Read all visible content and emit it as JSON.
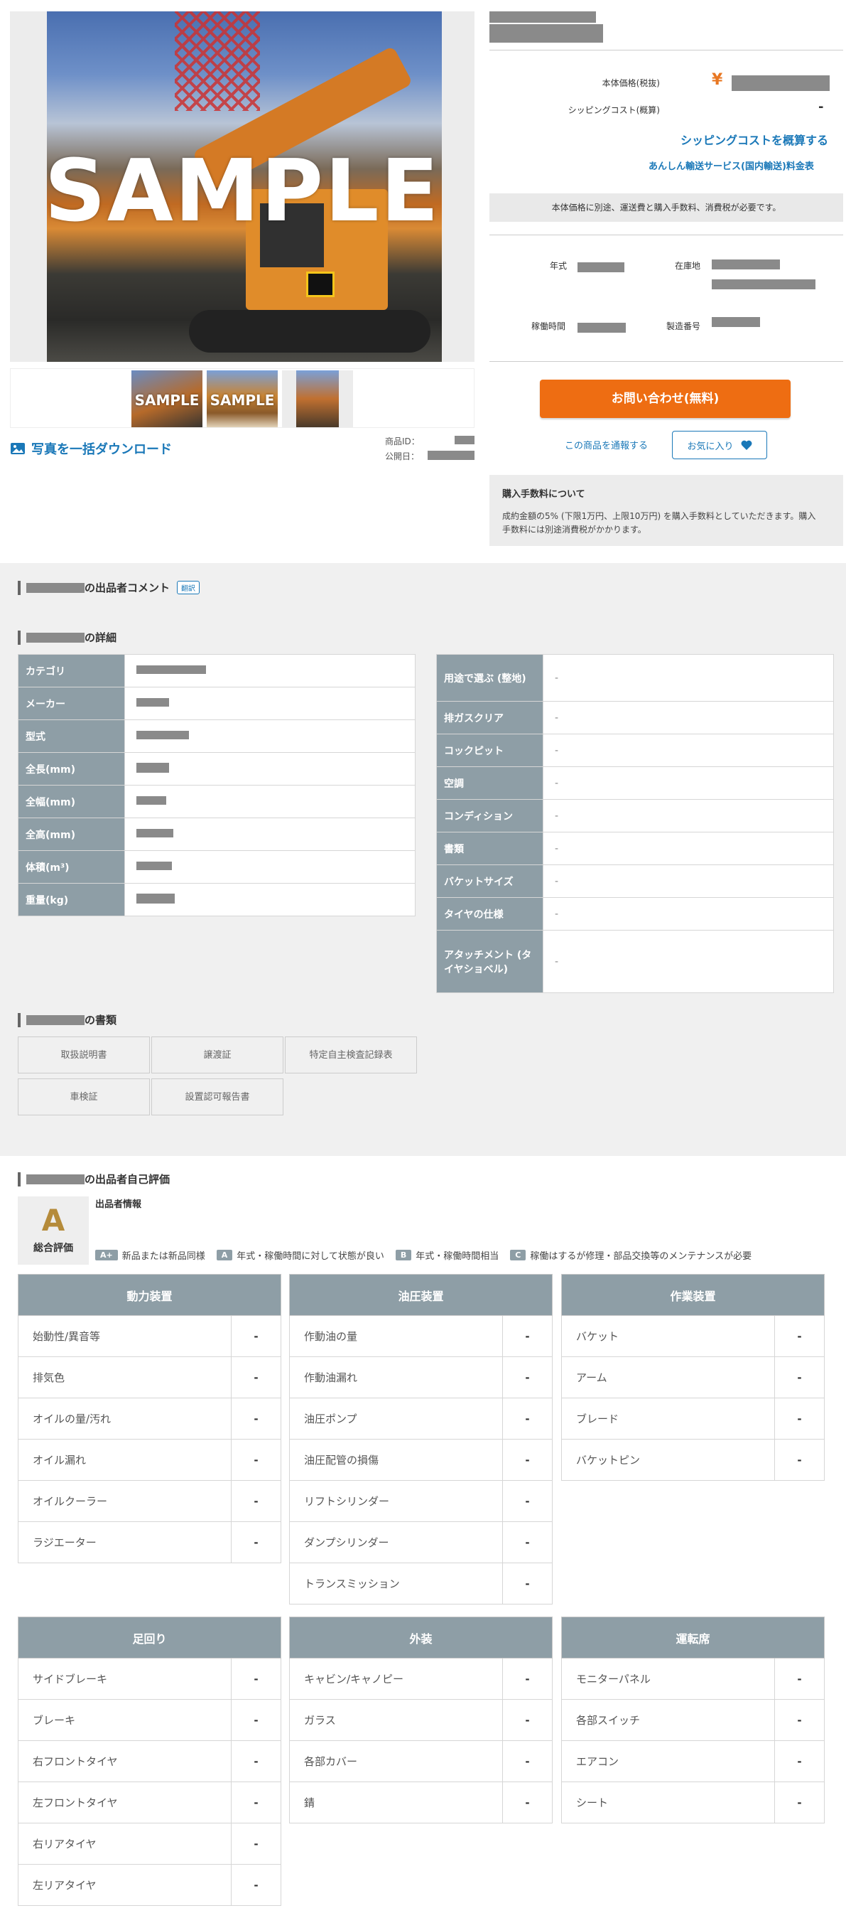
{
  "gallery": {
    "watermark": "SAMPLE",
    "thumbs": [
      {
        "label": "SAMPLE",
        "selected": true
      },
      {
        "label": "SAMPLE",
        "selected": false
      },
      {
        "label": "",
        "selected": false
      }
    ],
    "download_label": "写真を一括ダウンロード",
    "item_id_label": "商品ID：",
    "published_label": "公開日："
  },
  "pricing": {
    "body_price_label": "本体価格(税抜)",
    "yen_symbol": "¥",
    "shipping_label": "シッピングコスト(概算)",
    "shipping_value": "-",
    "shipping_link": "シッピングコストを概算する",
    "anshin_link": "あんしん輸送サービス(国内輸送)料金表",
    "note": "本体価格に別途、運送費と購入手数料、消費税が必要です。"
  },
  "specs": {
    "year_label": "年式",
    "location_label": "在庫地",
    "hours_label": "稼働時間",
    "serial_label": "製造番号"
  },
  "actions": {
    "inquiry": "お問い合わせ(無料)",
    "report": "この商品を通報する",
    "favorite": "お気に入り"
  },
  "fee": {
    "title": "購入手数料について",
    "text_line1": "成約金額の5% (下限1万円、上限10万円) を購入手数料としていただきます。購入",
    "text_line2": "手数料には別途消費税がかかります。"
  },
  "sections": {
    "comment_title": "の出品者コメント",
    "translate_badge": "翻訳",
    "details_title": "の詳細",
    "documents_title": "の書類",
    "eval_title": "の出品者自己評価"
  },
  "details_left": [
    {
      "label": "カテゴリ"
    },
    {
      "label": "メーカー"
    },
    {
      "label": "型式"
    },
    {
      "label": "全長(mm)"
    },
    {
      "label": "全幅(mm)"
    },
    {
      "label": "全高(mm)"
    },
    {
      "label": "体積(m³)"
    },
    {
      "label": "重量(kg)"
    }
  ],
  "details_right": [
    {
      "label": "用途で選ぶ (整地)",
      "value": "-"
    },
    {
      "label": "排ガスクリア",
      "value": "-"
    },
    {
      "label": "コックピット",
      "value": "-"
    },
    {
      "label": "空調",
      "value": "-"
    },
    {
      "label": "コンディション",
      "value": "-"
    },
    {
      "label": "書類",
      "value": "-"
    },
    {
      "label": "バケットサイズ",
      "value": "-"
    },
    {
      "label": "タイヤの仕様",
      "value": "-"
    },
    {
      "label": "アタッチメント (タイヤショベル)",
      "value": "-"
    }
  ],
  "documents": [
    "取扱説明書",
    "譲渡証",
    "特定自主検査記録表",
    "車検証",
    "設置認可報告書"
  ],
  "evaluation": {
    "grade": "A",
    "grade_label": "総合評価",
    "seller_info": "出品者情報",
    "legend": [
      {
        "chip": "A+",
        "text": "新品または新品同様"
      },
      {
        "chip": "A",
        "text": "年式・稼働時間に対して状態が良い"
      },
      {
        "chip": "B",
        "text": "年式・稼働時間相当"
      },
      {
        "chip": "C",
        "text": "稼働はするが修理・部品交換等のメンテナンスが必要"
      }
    ],
    "groups": [
      {
        "title": "動力装置",
        "rows": [
          [
            "始動性/異音等",
            "-"
          ],
          [
            "排気色",
            "-"
          ],
          [
            "オイルの量/汚れ",
            "-"
          ],
          [
            "オイル漏れ",
            "-"
          ],
          [
            "オイルクーラー",
            "-"
          ],
          [
            "ラジエーター",
            "-"
          ]
        ]
      },
      {
        "title": "油圧装置",
        "rows": [
          [
            "作動油の量",
            "-"
          ],
          [
            "作動油漏れ",
            "-"
          ],
          [
            "油圧ポンプ",
            "-"
          ],
          [
            "油圧配管の損傷",
            "-"
          ],
          [
            "リフトシリンダー",
            "-"
          ],
          [
            "ダンプシリンダー",
            "-"
          ],
          [
            "トランスミッション",
            "-"
          ]
        ]
      },
      {
        "title": "作業装置",
        "rows": [
          [
            "バケット",
            "-"
          ],
          [
            "アーム",
            "-"
          ],
          [
            "ブレード",
            "-"
          ],
          [
            "バケットピン",
            "-"
          ]
        ]
      },
      {
        "title": "足回り",
        "rows": [
          [
            "サイドブレーキ",
            "-"
          ],
          [
            "ブレーキ",
            "-"
          ],
          [
            "右フロントタイヤ",
            "-"
          ],
          [
            "左フロントタイヤ",
            "-"
          ],
          [
            "右リアタイヤ",
            "-"
          ],
          [
            "左リアタイヤ",
            "-"
          ]
        ]
      },
      {
        "title": "外装",
        "rows": [
          [
            "キャビン/キャノピー",
            "-"
          ],
          [
            "ガラス",
            "-"
          ],
          [
            "各部カバー",
            "-"
          ],
          [
            "錆",
            "-"
          ]
        ]
      },
      {
        "title": "運転席",
        "rows": [
          [
            "モニターパネル",
            "-"
          ],
          [
            "各部スイッチ",
            "-"
          ],
          [
            "エアコン",
            "-"
          ],
          [
            "シート",
            "-"
          ]
        ]
      }
    ]
  },
  "colors": {
    "accent_orange": "#ee6d12",
    "link_blue": "#1a78b8",
    "table_header": "#8e9ea6"
  },
  "icons": [
    "image-icon",
    "heart-icon"
  ]
}
